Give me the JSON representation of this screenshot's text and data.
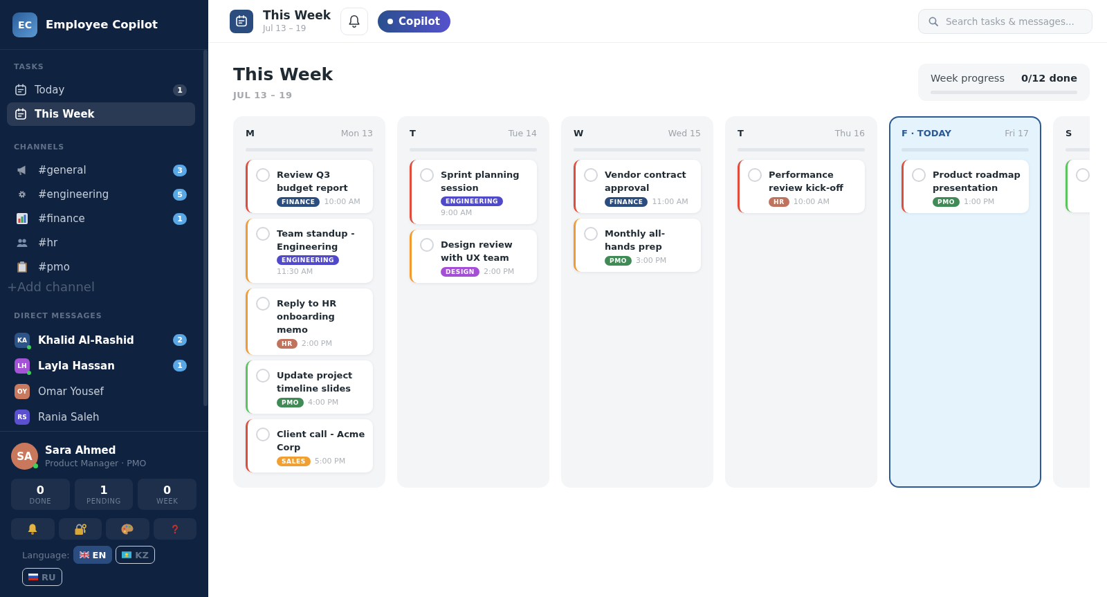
{
  "sidebar": {
    "brand": {
      "initials": "EC",
      "name": "Employee Copilot"
    },
    "tasks": {
      "heading": "TASKS",
      "items": [
        {
          "label": "Today",
          "badge": "1",
          "selected": false
        },
        {
          "label": "This Week",
          "selected": true
        }
      ]
    },
    "channels": {
      "heading": "CHANNELS",
      "items": [
        {
          "name": "#general",
          "badge": "3",
          "selected": false
        },
        {
          "name": "#engineering",
          "badge": "5",
          "selected": false
        },
        {
          "name": "#finance",
          "badge": "1",
          "selected": false
        },
        {
          "name": "#hr",
          "selected": false
        },
        {
          "name": "#pmo",
          "selected": false
        }
      ],
      "add_label": "+Add channel"
    },
    "direct_messages": {
      "heading": "DIRECT MESSAGES",
      "items": [
        {
          "initials": "KA",
          "name": "Khalid Al-Rashid",
          "color": "#2d5488",
          "online": true,
          "badge": "2",
          "selected": false
        },
        {
          "initials": "LH",
          "name": "Layla Hassan",
          "color": "#a452d6",
          "online": true,
          "badge": "1",
          "selected": false
        },
        {
          "initials": "OY",
          "name": "Omar Yousef",
          "color": "#c97a5e",
          "online": false,
          "selected": false
        },
        {
          "initials": "RS",
          "name": "Rania Saleh",
          "color": "#5b50d0",
          "online": false,
          "selected": false
        }
      ]
    },
    "user": {
      "initials": "SA",
      "name": "Sara Ahmed",
      "role": "Product Manager · PMO",
      "online": true,
      "stats": [
        {
          "value": "0",
          "label": "DONE"
        },
        {
          "value": "1",
          "label": "PENDING"
        },
        {
          "value": "0",
          "label": "WEEK"
        }
      ]
    },
    "language": {
      "label": "Language:",
      "options": [
        {
          "code": "EN",
          "selected": true
        },
        {
          "code": "KZ",
          "selected": false
        },
        {
          "code": "RU",
          "selected": false
        }
      ]
    }
  },
  "topbar": {
    "title": "This Week",
    "subtitle": "Jul 13 – 19",
    "copilot_label": "Copilot",
    "search": {
      "placeholder": "Search tasks & messages..."
    }
  },
  "header": {
    "title": "This Week",
    "subtitle": "JUL 13 – 19",
    "progress": {
      "label": "Week progress",
      "value": "0/12 done",
      "level": 0
    }
  },
  "columns": [
    {
      "day": "M",
      "date": "Mon 13",
      "today": false,
      "level": 0,
      "tasks": [
        {
          "title": "Review Q3 budget report",
          "tag": {
            "label": "FINANCE",
            "color": "#2b4c7e"
          },
          "time": "10:00 AM",
          "color": "#e04b3a",
          "done": false
        },
        {
          "title": "Team standup - Engineering",
          "tag": {
            "label": "ENGINEERING",
            "color": "#5049c9"
          },
          "time": "11:30 AM",
          "color": "#f29a2e",
          "done": false
        },
        {
          "title": "Reply to HR onboarding memo",
          "tag": {
            "label": "HR",
            "color": "#c0735c"
          },
          "time": "2:00 PM",
          "color": "#f29a2e",
          "done": false
        },
        {
          "title": "Update project timeline slides",
          "tag": {
            "label": "PMO",
            "color": "#3f8a55"
          },
          "time": "4:00 PM",
          "color": "#5cc45c",
          "done": false
        },
        {
          "title": "Client call - Acme Corp",
          "tag": {
            "label": "SALES",
            "color": "#f0a032"
          },
          "time": "5:00 PM",
          "color": "#e04b3a",
          "done": false
        }
      ]
    },
    {
      "day": "T",
      "date": "Tue 14",
      "today": false,
      "level": 0,
      "tasks": [
        {
          "title": "Sprint planning session",
          "tag": {
            "label": "ENGINEERING",
            "color": "#5049c9"
          },
          "time": "9:00 AM",
          "color": "#e04b3a",
          "done": false
        },
        {
          "title": "Design review with UX team",
          "tag": {
            "label": "DESIGN",
            "color": "#a54fd6"
          },
          "time": "2:00 PM",
          "color": "#f29a2e",
          "done": false
        }
      ]
    },
    {
      "day": "W",
      "date": "Wed 15",
      "today": false,
      "level": 0,
      "tasks": [
        {
          "title": "Vendor contract approval",
          "tag": {
            "label": "FINANCE",
            "color": "#2b4c7e"
          },
          "time": "11:00 AM",
          "color": "#e04b3a",
          "done": false
        },
        {
          "title": "Monthly all-hands prep",
          "tag": {
            "label": "PMO",
            "color": "#3f8a55"
          },
          "time": "3:00 PM",
          "color": "#f29a2e",
          "done": false
        }
      ]
    },
    {
      "day": "T",
      "date": "Thu 16",
      "today": false,
      "level": 0,
      "tasks": [
        {
          "title": "Performance review kick-off",
          "tag": {
            "label": "HR",
            "color": "#c0735c"
          },
          "time": "10:00 AM",
          "color": "#e04b3a",
          "done": false
        }
      ]
    },
    {
      "day": "F · TODAY",
      "date": "Fri 17",
      "today": true,
      "level": 0,
      "tasks": [
        {
          "title": "Product roadmap presentation",
          "tag": {
            "label": "PMO",
            "color": "#3f8a55"
          },
          "time": "1:00 PM",
          "color": "#e04b3a",
          "done": false
        }
      ]
    },
    {
      "day": "S",
      "today": false,
      "level": 0,
      "tasks": [
        {
          "color": "#5cc45c",
          "done": false
        }
      ]
    }
  ]
}
